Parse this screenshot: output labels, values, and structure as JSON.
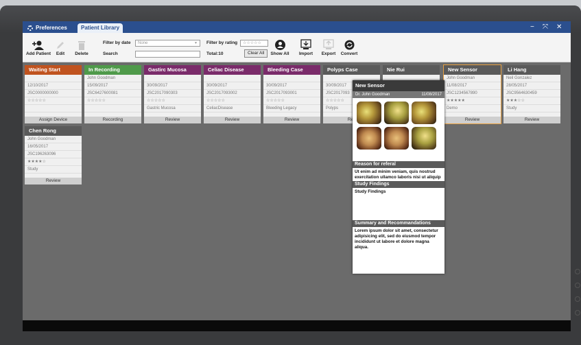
{
  "window": {
    "tabs": [
      {
        "label": "Preferences"
      },
      {
        "label": "Patient Library"
      }
    ],
    "controls": [
      "−",
      "⤧",
      "✕"
    ]
  },
  "toolbar": {
    "add_patient": "Add Patient",
    "edit": "Edit",
    "delete": "Delete",
    "filter_by_date_label": "Filter by date",
    "filter_by_date_value": "None",
    "search_label": "Search",
    "search_value": "",
    "filter_by_rating_label": "Filter by rating",
    "filter_by_rating_stars": "☆☆☆☆☆",
    "total": "Total:10",
    "clear_all": "Clear All",
    "show_all": "Show All",
    "import": "Import",
    "export": "Export",
    "convert": "Convert"
  },
  "cards": [
    {
      "title": "Waiting Start",
      "color": "#c0531f",
      "rows": [
        "",
        "12/10/2017",
        "JSC0000000000",
        "☆☆☆☆☆",
        ""
      ],
      "action": "Assign Device"
    },
    {
      "title": "In Recording",
      "color": "#4f9a4a",
      "rows": [
        "John Goodman",
        "15/09/2017",
        "JSC6427600081",
        "☆☆☆☆☆",
        ""
      ],
      "action": "Recording"
    },
    {
      "title": "Gastirc Mucosa",
      "color": "#7a2b6a",
      "rows": [
        "",
        "30/09/2017",
        "JSC2017090303",
        "☆☆☆☆☆",
        "Gastric Mucosa"
      ],
      "action": "Review"
    },
    {
      "title": "Celiac Disease",
      "color": "#7a2b6a",
      "rows": [
        "",
        "30/09/2017",
        "JSC2017093002",
        "☆☆☆☆☆",
        "CeliacDisease"
      ],
      "action": "Review"
    },
    {
      "title": "Bleeding Case",
      "color": "#7a2b6a",
      "rows": [
        "",
        "30/09/2017",
        "JSC2017093001",
        "☆☆☆☆☆",
        "Bleeding Legacy"
      ],
      "action": "Review"
    },
    {
      "title": "Polyps Case",
      "color": "#5a5a5a",
      "rows": [
        "",
        "30/09/2017",
        "JSC2017093",
        "☆☆☆☆☆",
        "Polyps"
      ],
      "action": "Rev"
    },
    {
      "title": "Nie Rui",
      "color": "#5a5a5a",
      "rows": [
        "",
        "",
        "",
        "",
        ""
      ],
      "action": ""
    },
    {
      "title": "New Sensor",
      "color": "#5a5a5a",
      "rows": [
        "John Goodman",
        "11/08/2017",
        "JSC1234567890",
        "★★★★★",
        "Demo"
      ],
      "action": "Review"
    },
    {
      "title": "Li Hang",
      "color": "#5a5a5a",
      "rows": [
        "Neil Gonzalez",
        "28/05/2017",
        "JSC9564630459",
        "★★★☆☆",
        "Study"
      ],
      "action": "Review"
    },
    {
      "title": "Chen Rong",
      "color": "#5a5a5a",
      "rows": [
        "John Goodman",
        "16/05/2017",
        "JSC196263096",
        "★★★★☆",
        "Study"
      ],
      "action": "Review"
    }
  ],
  "popup": {
    "title": "New Sensor",
    "doctor": "Dr. John Goodman",
    "date": "11/08/2017",
    "reason_header": "Reason for referal",
    "reason_text": "Ut enim ad minim veniam, quis nostrud exercitation ullamco laboris nisi ut aliquip ex",
    "findings_header": "Study Findings",
    "findings_text": "Study Findings",
    "summary_header": "Summary and Recommandations",
    "summary_text": "Lorem ipsum dolor sit amet, consectetur adipisicing elit, sed do eiusmod tempor incididunt ut labore et dolore magna aliqua."
  }
}
